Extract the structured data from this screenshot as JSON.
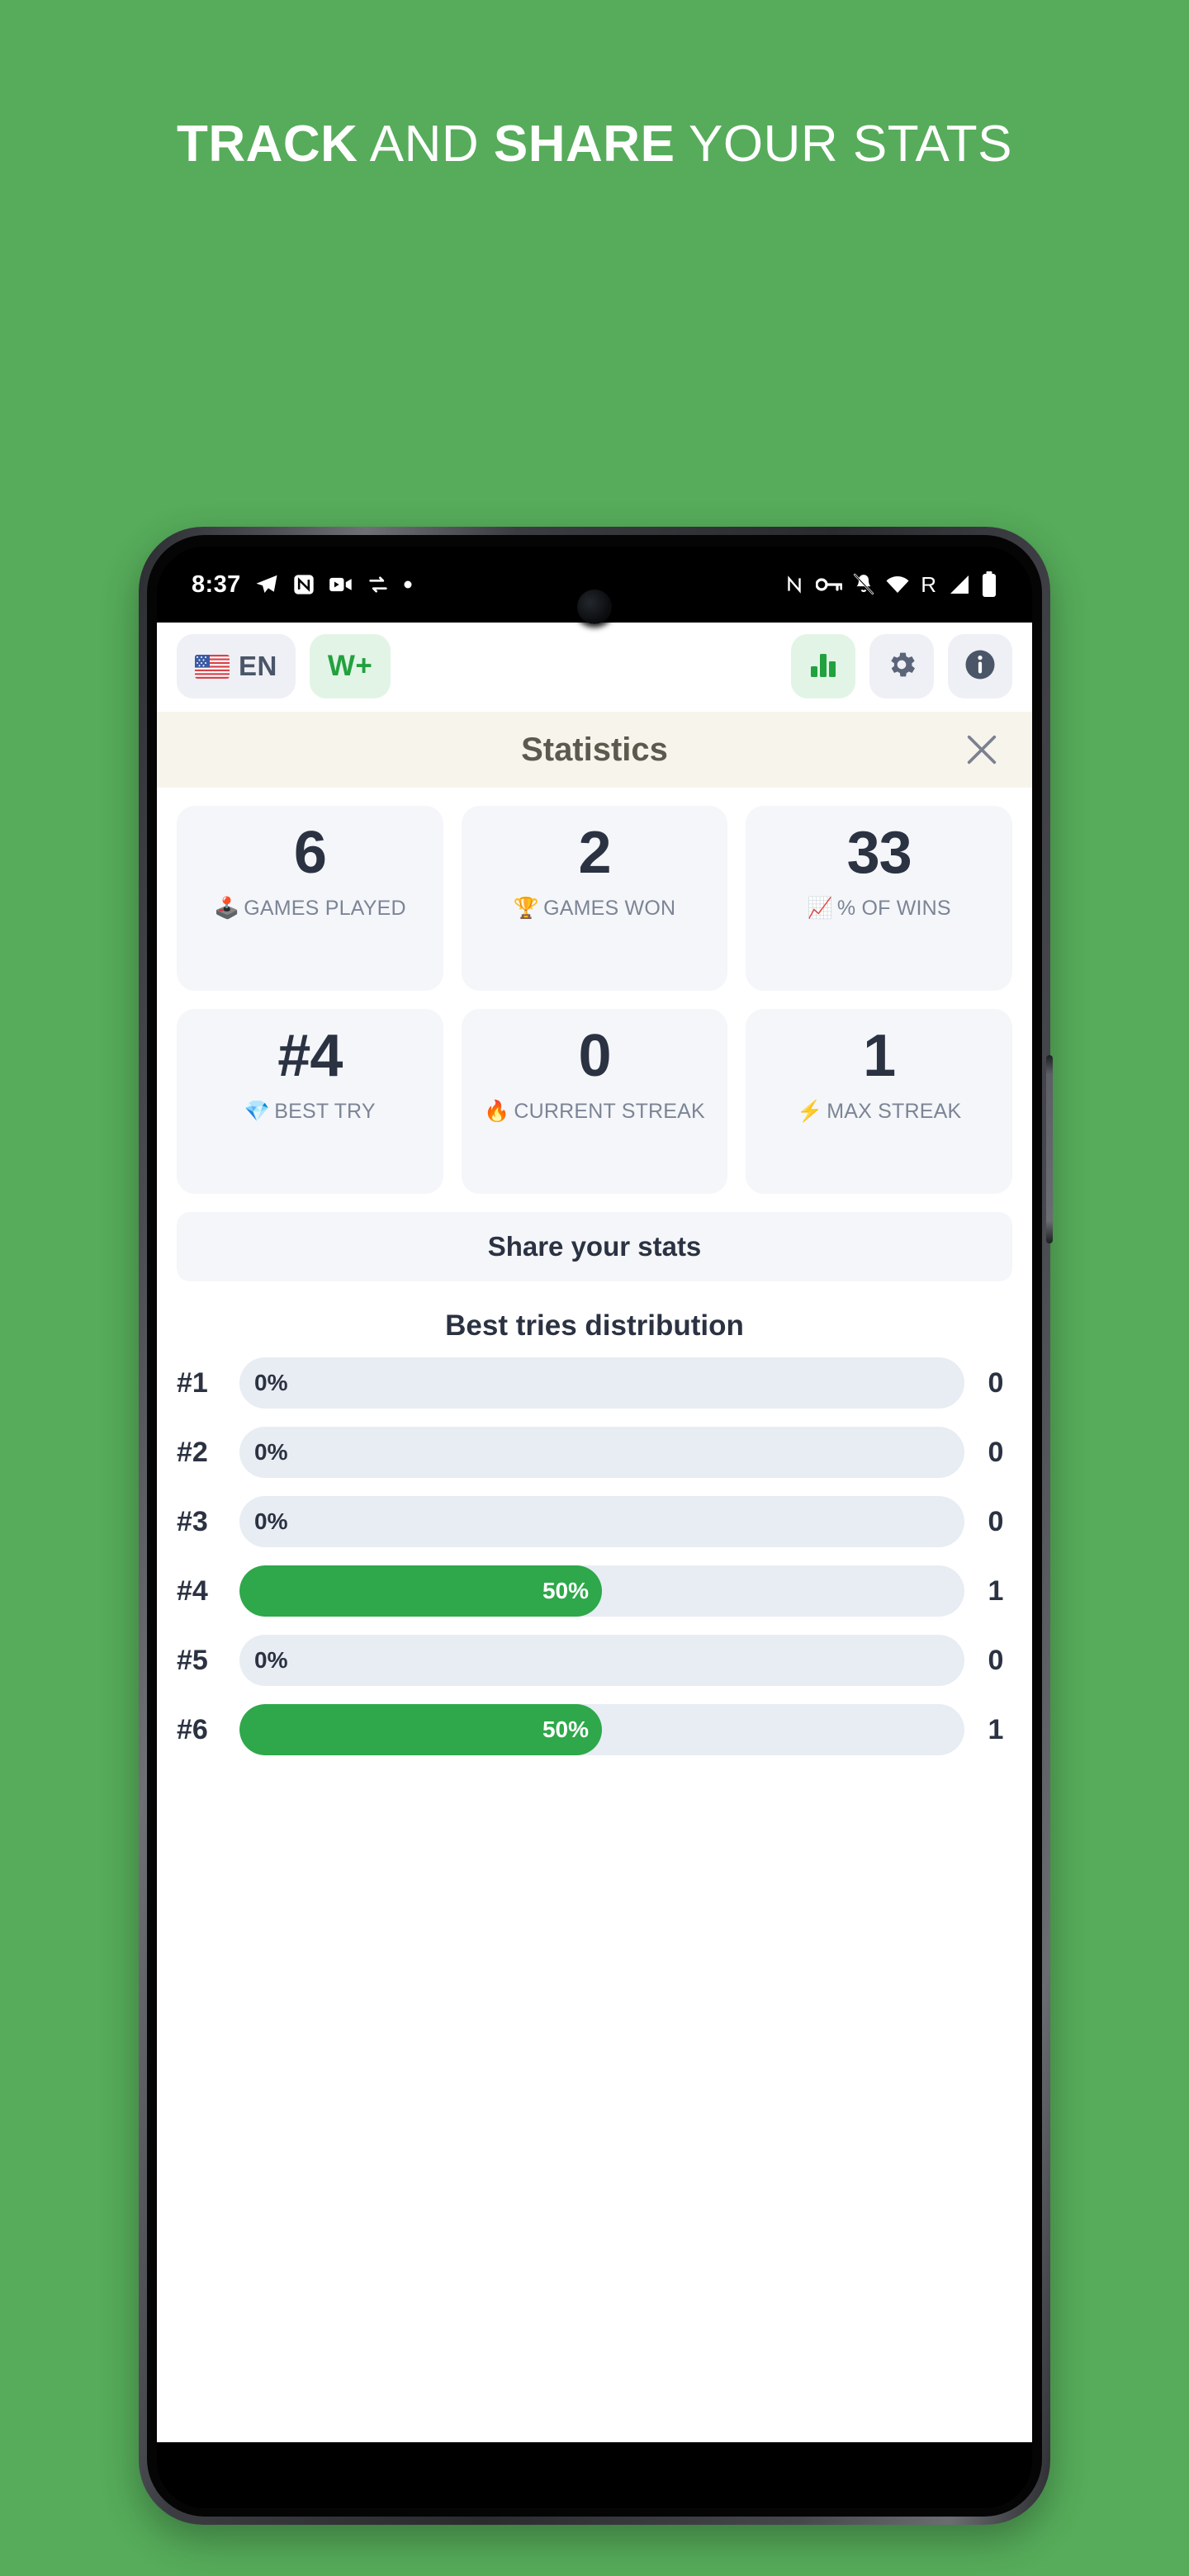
{
  "promo": {
    "headline_part1": "TRACK",
    "headline_part2": " AND ",
    "headline_part3": "SHARE",
    "headline_part4": " YOUR STATS",
    "background_color": "#56ac5a"
  },
  "status_bar": {
    "time": "8:37",
    "left_icons": [
      "telegram-icon",
      "nfc-badge-icon",
      "video-recording-icon",
      "sync-icon",
      "dot-icon"
    ],
    "right_icons": [
      "nfc-icon",
      "vpn-key-icon",
      "silent-bell-icon",
      "wifi-icon",
      "roaming-r-icon",
      "signal-icon",
      "battery-icon"
    ],
    "roaming_label": "R"
  },
  "app_header": {
    "language_chip": {
      "label": "EN",
      "flag": "us-flag-icon"
    },
    "mode_chip": {
      "label": "W+"
    },
    "actions": [
      {
        "name": "stats-icon",
        "active": true
      },
      {
        "name": "settings-gear-icon",
        "active": false
      },
      {
        "name": "info-icon",
        "active": false
      }
    ]
  },
  "modal": {
    "title": "Statistics",
    "close_label": "×",
    "title_bar_color": "#f7f4ec"
  },
  "stats_cards": [
    {
      "value": "6",
      "emoji": "🕹️",
      "label": "GAMES PLAYED",
      "icon": "joystick-icon"
    },
    {
      "value": "2",
      "emoji": "🏆",
      "label": "GAMES WON",
      "icon": "trophy-icon"
    },
    {
      "value": "33",
      "emoji": "📈",
      "label": "% OF WINS",
      "icon": "chart-increasing-icon"
    },
    {
      "value": "#4",
      "emoji": "💎",
      "label": "BEST TRY",
      "icon": "gem-icon"
    },
    {
      "value": "0",
      "emoji": "🔥",
      "label": "CURRENT STREAK",
      "icon": "fire-icon"
    },
    {
      "value": "1",
      "emoji": "⚡",
      "label": "MAX STREAK",
      "icon": "lightning-icon"
    }
  ],
  "share_button": {
    "label": "Share your stats"
  },
  "distribution": {
    "title": "Best tries distribution",
    "accent_color": "#2ea84a",
    "track_color": "#e8ecf3"
  },
  "chart_data": {
    "type": "bar",
    "title": "Best tries distribution",
    "orientation": "horizontal",
    "categories": [
      "#1",
      "#2",
      "#3",
      "#4",
      "#5",
      "#6"
    ],
    "values": [
      0,
      0,
      0,
      50,
      0,
      50
    ],
    "value_labels": [
      "0%",
      "0%",
      "0%",
      "50%",
      "0%",
      "50%"
    ],
    "counts": [
      0,
      0,
      0,
      1,
      0,
      1
    ],
    "count_labels": [
      "0",
      "0",
      "0",
      "1",
      "0",
      "1"
    ],
    "xlabel": "",
    "ylabel": "",
    "xlim": [
      0,
      100
    ],
    "grid": false,
    "legend": "none"
  }
}
